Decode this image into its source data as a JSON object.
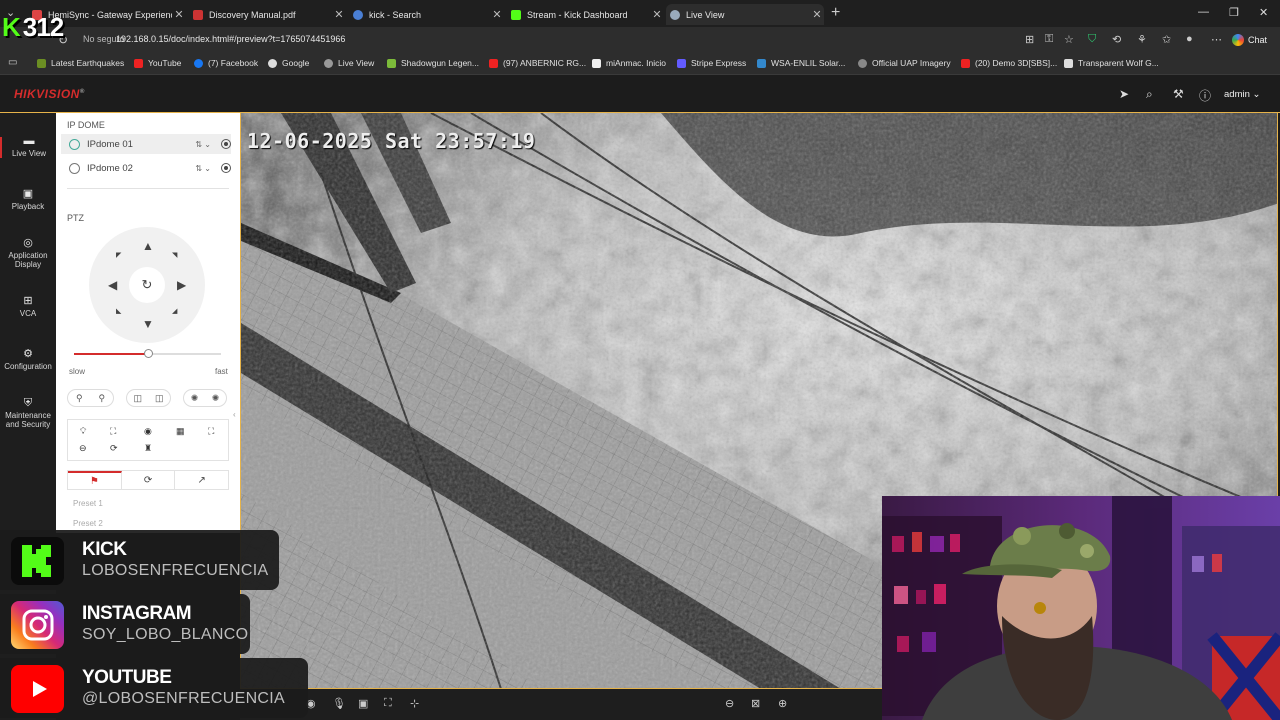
{
  "browser": {
    "tabs": [
      {
        "title": "HemiSync - Gateway Experience -",
        "favicon": "#d44"
      },
      {
        "title": "Discovery Manual.pdf",
        "favicon": "#c33"
      },
      {
        "title": "kick - Search",
        "favicon": "#4a7fd4"
      },
      {
        "title": "Stream - Kick Dashboard",
        "favicon": "#53fc18"
      },
      {
        "title": "Live View",
        "favicon": "#9ab"
      }
    ],
    "site_info": "No seguro",
    "url": "192.168.0.15/doc/index.html#/preview?t=1765074451966",
    "chat_label": "Chat",
    "bookmarks": [
      {
        "label": "Latest Earthquakes",
        "color": "#6b8e23"
      },
      {
        "label": "YouTube",
        "color": "#e22"
      },
      {
        "label": "(7) Facebook",
        "color": "#1877f2"
      },
      {
        "label": "Google",
        "color": "#ddd"
      },
      {
        "label": "Live View",
        "color": "#999"
      },
      {
        "label": "Shadowgun Legen...",
        "color": "#7cbb3a"
      },
      {
        "label": "(97) ANBERNIC RG...",
        "color": "#e22"
      },
      {
        "label": "miAnmac. Inicio",
        "color": "#eee"
      },
      {
        "label": "Stripe Express",
        "color": "#635bff"
      },
      {
        "label": "WSA-ENLIL Solar...",
        "color": "#38c"
      },
      {
        "label": "Official UAP Imagery",
        "color": "#888"
      },
      {
        "label": "(20) Demo 3D[SBS]...",
        "color": "#e22"
      },
      {
        "label": "Transparent Wolf G...",
        "color": "#ddd"
      }
    ]
  },
  "hik": {
    "logo": "HIKVISION",
    "logo_mark": "®",
    "user": "admin",
    "nav": [
      {
        "label": "Live View",
        "icon": "live-view-icon"
      },
      {
        "label": "Playback",
        "icon": "playback-icon"
      },
      {
        "label": "Application Display",
        "icon": "application-icon"
      },
      {
        "label": "VCA",
        "icon": "vca-icon"
      },
      {
        "label": "Configuration",
        "icon": "gear-icon"
      },
      {
        "label": "Maintenance and Security",
        "icon": "maintenance-icon"
      }
    ],
    "panel": {
      "group_label": "IP DOME",
      "cameras": [
        "IPdome 01",
        "IPdome 02"
      ],
      "ptz_label": "PTZ",
      "speed_slow": "slow",
      "speed_fast": "fast",
      "speed_level": 0.5,
      "presets": [
        "Preset 1",
        "Preset 2"
      ]
    },
    "timestamp": "12-06-2025 Sat 23:57:19"
  },
  "stream": {
    "viewer_count": "312",
    "socials": [
      {
        "platform": "KICK",
        "handle": "LOBOSENFRECUENCIA",
        "color": "#53fc18"
      },
      {
        "platform": "INSTAGRAM",
        "handle": "SOY_LOBO_BLANCO",
        "color": "#d62976"
      },
      {
        "platform": "YOUTUBE",
        "handle": "@LOBOSENFRECUENCIA",
        "color": "#ff0000"
      }
    ]
  },
  "colors": {
    "hik_red": "#d42c2c",
    "accent_border": "#e6b34a",
    "kick_green": "#53fc18"
  }
}
